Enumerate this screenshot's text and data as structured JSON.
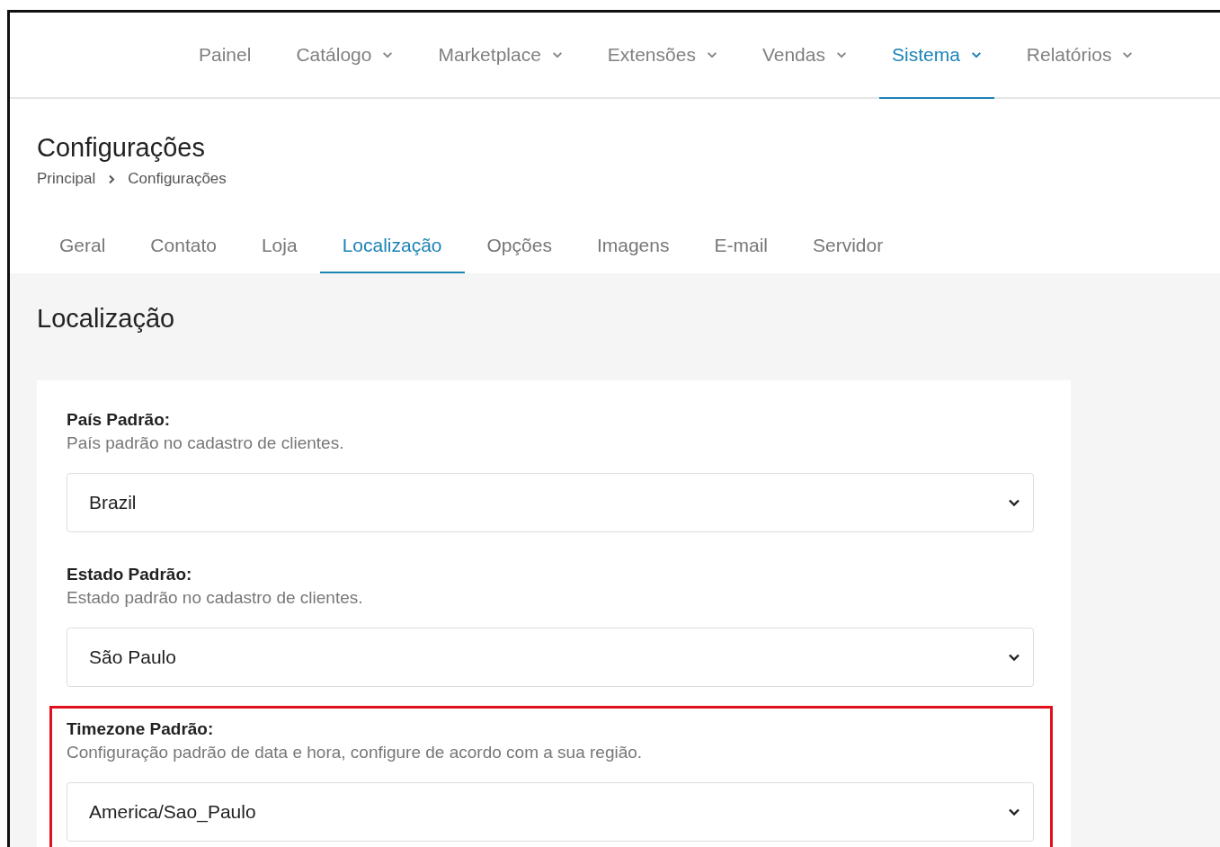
{
  "top_nav": [
    {
      "label": "Painel",
      "selected": false,
      "dropdown": false
    },
    {
      "label": "Catálogo",
      "selected": false,
      "dropdown": true
    },
    {
      "label": "Marketplace",
      "selected": false,
      "dropdown": true
    },
    {
      "label": "Extensões",
      "selected": false,
      "dropdown": true
    },
    {
      "label": "Vendas",
      "selected": false,
      "dropdown": true
    },
    {
      "label": "Sistema",
      "selected": true,
      "dropdown": true
    },
    {
      "label": "Relatórios",
      "selected": false,
      "dropdown": true
    }
  ],
  "page_title": "Configurações",
  "breadcrumb": [
    "Principal",
    "Configurações"
  ],
  "tabs": [
    {
      "label": "Geral",
      "selected": false
    },
    {
      "label": "Contato",
      "selected": false
    },
    {
      "label": "Loja",
      "selected": false
    },
    {
      "label": "Localização",
      "selected": true
    },
    {
      "label": "Opções",
      "selected": false
    },
    {
      "label": "Imagens",
      "selected": false
    },
    {
      "label": "E-mail",
      "selected": false
    },
    {
      "label": "Servidor",
      "selected": false
    }
  ],
  "section_title": "Localização",
  "fields": [
    {
      "label": "País Padrão:",
      "help": "País padrão no cadastro de clientes.",
      "value": "Brazil",
      "highlighted": false
    },
    {
      "label": "Estado Padrão:",
      "help": "Estado padrão no cadastro de clientes.",
      "value": "São Paulo",
      "highlighted": false
    },
    {
      "label": "Timezone Padrão:",
      "help": "Configuração padrão de data e hora, configure de acordo com a sua região.",
      "value": "America/Sao_Paulo",
      "highlighted": true
    }
  ]
}
